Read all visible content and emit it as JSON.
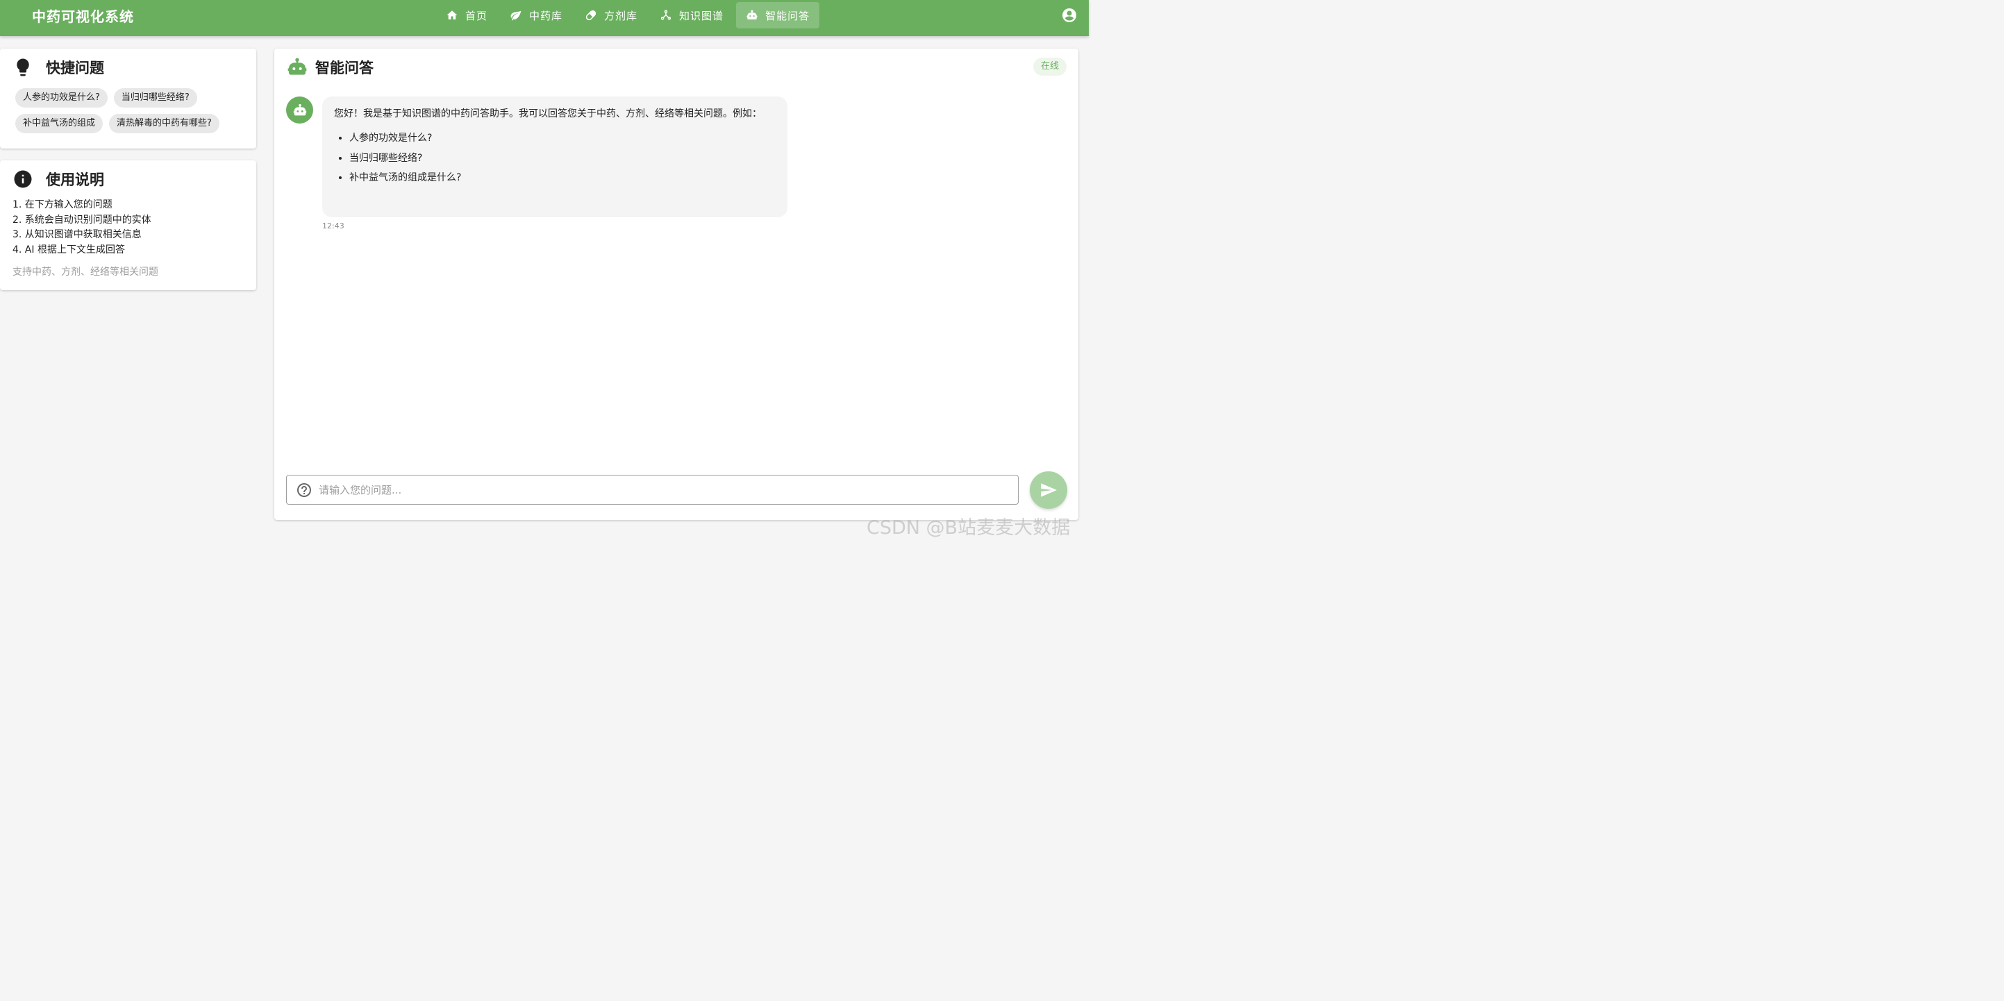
{
  "app": {
    "brand": "中药可视化系统"
  },
  "nav": {
    "items": [
      {
        "label": "首页",
        "icon": "home-icon"
      },
      {
        "label": "中药库",
        "icon": "leaf-icon"
      },
      {
        "label": "方剂库",
        "icon": "pill-icon"
      },
      {
        "label": "知识图谱",
        "icon": "graph-icon"
      },
      {
        "label": "智能问答",
        "icon": "robot-icon",
        "active": true
      }
    ],
    "account_icon": "account-circle-icon"
  },
  "quick": {
    "title": "快捷问题",
    "icon": "lightbulb-icon",
    "chips": [
      "人参的功效是什么?",
      "当归归哪些经络?",
      "补中益气汤的组成",
      "清热解毒的中药有哪些?"
    ]
  },
  "usage": {
    "title": "使用说明",
    "icon": "info-icon",
    "steps": [
      "1. 在下方输入您的问题",
      "2. 系统会自动识别问题中的实体",
      "3. 从知识图谱中获取相关信息",
      "4. AI 根据上下文生成回答"
    ],
    "note": "支持中药、方剂、经络等相关问题"
  },
  "chat": {
    "title": "智能问答",
    "icon": "robot-icon",
    "status": "在线",
    "message": {
      "intro": "您好！我是基于知识图谱的中药问答助手。我可以回答您关于中药、方剂、经络等相关问题。例如：",
      "examples": [
        "人参的功效是什么?",
        "当归归哪些经络?",
        "补中益气汤的组成是什么?"
      ],
      "time": "12:43"
    },
    "input_placeholder": "请输入您的问题...",
    "input_icon": "help-circle-icon",
    "send_icon": "send-icon"
  },
  "watermark": "CSDN @B站麦麦大数据",
  "colors": {
    "primary": "#6aaf5e",
    "send_disabled": "#a9d3a3",
    "status_bg": "#eef6ec"
  }
}
